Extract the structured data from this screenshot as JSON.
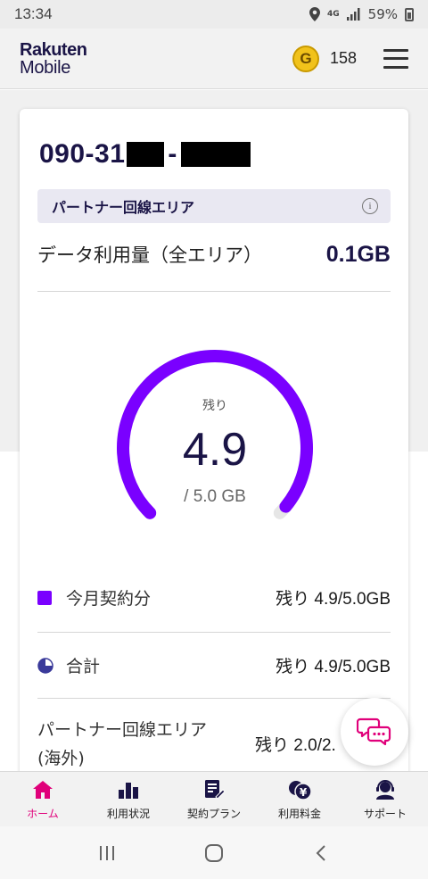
{
  "status_bar": {
    "time": "13:34",
    "network": "4G",
    "battery": "59%"
  },
  "header": {
    "logo_line1": "Rakuten",
    "logo_line2": "Mobile",
    "coin_letter": "G",
    "points": "158"
  },
  "card": {
    "phone_prefix": "090-31",
    "phone_sep": "-",
    "partner_area_label": "パートナー回線エリア",
    "usage_label": "データ利用量（全エリア）",
    "usage_value": "0.1GB",
    "gauge": {
      "remaining_label": "残り",
      "remaining_value": "4.9",
      "total": "/ 5.0 GB",
      "fraction_remaining": 0.98,
      "color": "#7a00ff"
    },
    "rows": [
      {
        "label": "今月契約分",
        "value": "残り 4.9/5.0GB",
        "icon": "purple-square-icon"
      },
      {
        "label": "合計",
        "value": "残り 4.9/5.0GB",
        "icon": "pie-chart-icon"
      }
    ],
    "overseas": {
      "label_line1": "パートナー回線エリア",
      "label_line2": "(海外)",
      "value": "残り 2.0/2."
    }
  },
  "tabs": [
    {
      "label": "ホーム",
      "icon": "home-icon",
      "active": true
    },
    {
      "label": "利用状況",
      "icon": "bar-chart-icon",
      "active": false
    },
    {
      "label": "契約プラン",
      "icon": "contract-icon",
      "active": false
    },
    {
      "label": "利用料金",
      "icon": "fee-icon",
      "active": false
    },
    {
      "label": "サポート",
      "icon": "support-icon",
      "active": false
    }
  ],
  "colors": {
    "accent": "#7a00ff",
    "brand_navy": "#1a1446",
    "active_tab": "#e0007a"
  }
}
